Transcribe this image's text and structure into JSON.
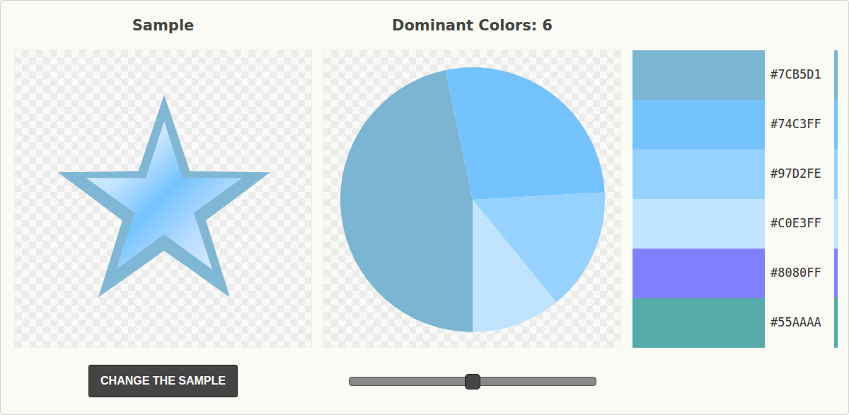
{
  "sample": {
    "title": "Sample",
    "button": "CHANGE THE SAMPLE"
  },
  "chart": {
    "title": "Dominant Colors: 6",
    "values": [
      46.7,
      27.4,
      15.0,
      10.9,
      0,
      0
    ]
  },
  "colors": [
    {
      "label": "#7CB5D1",
      "color": "#7CB5D1"
    },
    {
      "label": "#74C3FF",
      "color": "#74C3FF"
    },
    {
      "label": "#97D2FE",
      "color": "#97D2FE"
    },
    {
      "label": "#C0E3FF",
      "color": "#C0E3FF"
    },
    {
      "label": "#8080FF",
      "color": "#8080FF"
    },
    {
      "label": "#55AAAA",
      "color": "#55AAAA"
    }
  ],
  "slider": {
    "level": 0.5
  }
}
